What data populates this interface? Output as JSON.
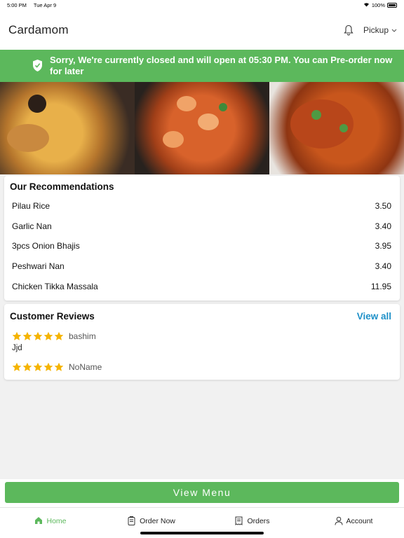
{
  "status": {
    "time": "5:00 PM",
    "date": "Tue Apr 9",
    "battery": "100%"
  },
  "header": {
    "title": "Cardamom",
    "mode": "Pickup"
  },
  "banner": {
    "message": "Sorry, We're currently closed and will open at 05:30 PM. You can Pre-order now for later"
  },
  "recommendations": {
    "title": "Our Recommendations",
    "items": [
      {
        "name": "Pilau Rice",
        "price": "3.50"
      },
      {
        "name": "Garlic Nan",
        "price": "3.40"
      },
      {
        "name": "3pcs Onion Bhajis",
        "price": "3.95"
      },
      {
        "name": "Peshwari Nan",
        "price": "3.40"
      },
      {
        "name": "Chicken Tikka Massala",
        "price": "11.95"
      }
    ]
  },
  "reviews": {
    "title": "Customer Reviews",
    "view_all": "View all",
    "items": [
      {
        "name": "bashim",
        "rating": 5,
        "text": "Jjd"
      },
      {
        "name": "NoName",
        "rating": 5,
        "text": ""
      }
    ]
  },
  "view_menu": "View Menu",
  "tabs": [
    {
      "label": "Home",
      "icon": "home-icon",
      "active": true
    },
    {
      "label": "Order Now",
      "icon": "order-icon",
      "active": false
    },
    {
      "label": "Orders",
      "icon": "receipt-icon",
      "active": false
    },
    {
      "label": "Account",
      "icon": "user-icon",
      "active": false
    }
  ],
  "colors": {
    "accent": "#5cb85c",
    "link": "#1e90c8",
    "star": "#f5b400"
  }
}
